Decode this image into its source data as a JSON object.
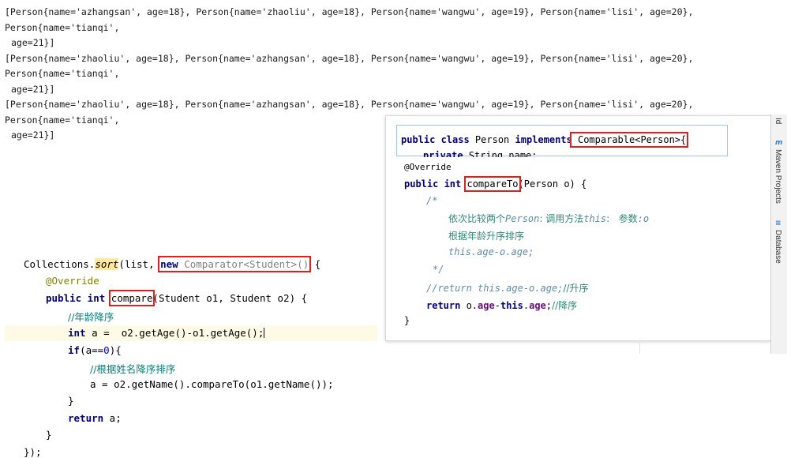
{
  "output": {
    "lines": [
      "[Person{name='azhangsan', age=18}, Person{name='zhaoliu', age=18}, Person{name='wangwu', age=19}, Person{name='lisi', age=20}, Person{name='tianqi',",
      "age=21}]",
      "[Person{name='zhaoliu', age=18}, Person{name='azhangsan', age=18}, Person{name='wangwu', age=19}, Person{name='lisi', age=20}, Person{name='tianqi',",
      "age=21}]",
      "[Person{name='zhaoliu', age=18}, Person{name='azhangsan', age=18}, Person{name='wangwu', age=19}, Person{name='lisi', age=20}, Person{name='tianqi',",
      "age=21}]"
    ]
  },
  "editor": {
    "l1_a": "Collections.",
    "l1_sort": "sort",
    "l1_b": "(list, ",
    "l1_new": "new",
    "l1_comp": " Comparator<Student>(",
    "l1_c": ")",
    "l1_d": " {",
    "l2": "@Override",
    "l3_kw": "public int",
    "l3_sp": " ",
    "l3_compare": "compare",
    "l3_rest": "(Student o1, Student o2) {",
    "l4": "//年龄降序",
    "l5_kw": "int",
    "l5_rest": " a =  o2.getAge()-o1.getAge();",
    "l6_kw": "if",
    "l6_a": "(a==",
    "l6_num": "0",
    "l6_b": "){",
    "l7": "//根据姓名降序排序",
    "l8": "a = o2.getName().compareTo(o1.getName());",
    "l9": "}",
    "l10_kw": "return",
    "l10_rest": " a;",
    "l11": "}",
    "l12": "});"
  },
  "popup": {
    "h1_kw1": "public class",
    "h1_name": " Person ",
    "h1_kw2": "implements",
    "h1_iface": " Comparable<Person>",
    "h1_brace": "{",
    "h2_kw": "private",
    "h2_rest": " String name;",
    "p1": "@Override",
    "p2_kw": "public int",
    "p2_sp": " ",
    "p2_method": "compareTo",
    "p2_rest": "(Person o) {",
    "p3": "/*",
    "p4_a": "依次比较两个",
    "p4_b": "Person",
    "p4_c": ": 调用方法",
    "p4_d": "this",
    "p4_e": ":   参数",
    "p4_f": ":o",
    "p5": "根据年龄升序排序",
    "p6": "this.age-o.age;",
    "p7": "*/",
    "p8_a": "//return this.age-o.age;",
    "p8_b": "//升序",
    "p9_kw": "return",
    "p9_a": " o.",
    "p9_f1": "age",
    "p9_b": "-",
    "p9_kw2": "this",
    "p9_c": ".",
    "p9_f2": "age",
    "p9_d": ";",
    "p9_cm": "//降序",
    "p10": "}"
  },
  "sidebar": {
    "tab_id": "Id",
    "tab_maven": "Maven Projects",
    "tab_database": "Database",
    "icon_m": "m",
    "icon_db": "≡"
  }
}
